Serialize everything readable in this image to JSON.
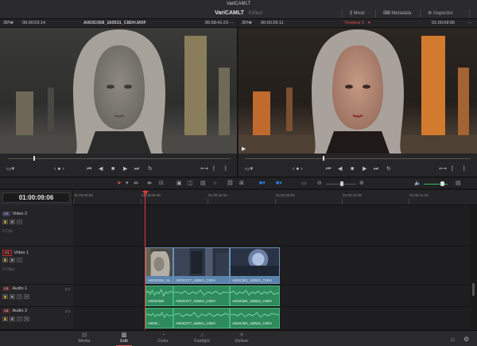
{
  "window": {
    "title": "VariCAMLT"
  },
  "appbar": {
    "project": "VariCAMLT",
    "status": "Edited",
    "mixer_label": "Mixer",
    "metadata_label": "Metadata",
    "inspector_label": "Inspector"
  },
  "source_viewer": {
    "zoom": "35%",
    "timecode_left": "00:00:03:14",
    "clip_name": "A003C058_160531_C8DH.MXF",
    "timecode_right": "05:58:41:23"
  },
  "timeline_viewer": {
    "zoom": "35%",
    "timecode_left": "00:00:26:11",
    "timeline_name": "Timeline 1",
    "timecode_right": "01:00:09:06"
  },
  "timeline": {
    "current_timecode": "01:00:09:06",
    "ruler_labels": [
      "01:00:00:00",
      "01:00:08:08",
      "01:00:16:16",
      "01:00:25:00",
      "01:00:33:08",
      "01:00:41:16"
    ],
    "tracks": {
      "v2": {
        "badge": "V2",
        "name": "Video 2",
        "sub": "0 Clip"
      },
      "v1": {
        "badge": "V1",
        "name": "Video 1",
        "sub": "3 Clips"
      },
      "a1": {
        "badge": "A1",
        "name": "Audio 1",
        "volume": "2.0"
      },
      "a2": {
        "badge": "A2",
        "name": "Audio 2",
        "volume": "2.0"
      }
    },
    "video_clips": [
      {
        "label": "A003C058_16..."
      },
      {
        "label": "A003C077_160601_C8DH"
      },
      {
        "label": "A003C081_160531_C8DH"
      }
    ],
    "audio1_clips": [
      {
        "label": "A003C058"
      },
      {
        "label": "A003C077_160601_C8DH"
      },
      {
        "label": "A003C081_160531_C8DH"
      }
    ],
    "audio2_clips": [
      {
        "label": "A003C..."
      },
      {
        "label": "A003C077_160601_C8DH"
      },
      {
        "label": "A003C081_160531_C8DH"
      }
    ]
  },
  "pages": [
    {
      "label": "Media",
      "icon": "media-icon"
    },
    {
      "label": "Edit",
      "icon": "edit-icon",
      "active": true
    },
    {
      "label": "Color",
      "icon": "color-icon"
    },
    {
      "label": "Fairlight",
      "icon": "fairlight-icon"
    },
    {
      "label": "Deliver",
      "icon": "deliver-icon"
    }
  ],
  "colors": {
    "accent_red": "#e03a3a",
    "video_clip": "#5b84ad",
    "audio_clip": "#2f8a5c"
  }
}
